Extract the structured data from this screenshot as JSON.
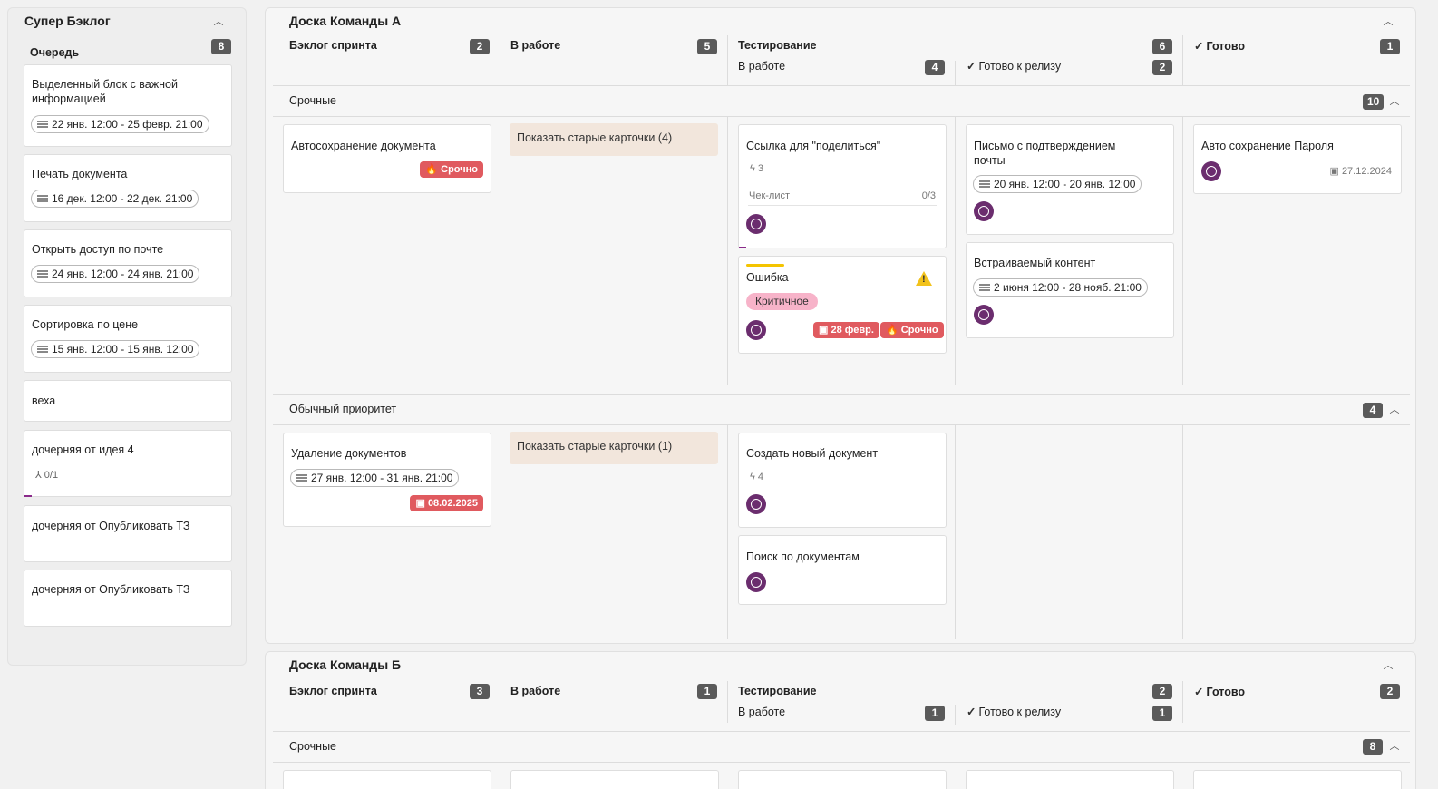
{
  "backlog": {
    "title": "Супер Бэклог",
    "queue_label": "Очередь",
    "queue_count": "8",
    "cards": [
      {
        "title": "Выделенный блок с важной информацией",
        "date": "22 янв. 12:00 - 25 февр. 21:00"
      },
      {
        "title": "Печать документа",
        "date": "16 дек. 12:00 - 22 дек. 21:00"
      },
      {
        "title": "Открыть доступ по почте",
        "date": "24 янв. 12:00 - 24 янв. 21:00"
      },
      {
        "title": "Сортировка по цене",
        "date": "15 янв. 12:00 - 15 янв. 12:00"
      },
      {
        "title": "веха"
      },
      {
        "title": "дочерняя от идея 4",
        "subtasks": "0/1"
      },
      {
        "title": "дочерняя от Опубликовать ТЗ"
      },
      {
        "title": "дочерняя от Опубликовать ТЗ"
      }
    ]
  },
  "board_a": {
    "title": "Доска Команды А",
    "columns": [
      {
        "label": "Бэклог спринта",
        "count": "2"
      },
      {
        "label": "В работе",
        "count": "5"
      },
      {
        "label": "Тестирование",
        "count": "6",
        "sub_left": "В работе",
        "sub_left_count": "4",
        "sub_right": "Готово к релизу",
        "sub_right_count": "2"
      },
      {
        "label": "Готово",
        "count": "1"
      }
    ],
    "lanes": [
      {
        "title": "Срочные",
        "count": "10"
      },
      {
        "title": "Обычный приоритет",
        "count": "4"
      }
    ],
    "urgent": {
      "c1": {
        "title": "Автосохранение документа",
        "tag": "Срочно"
      },
      "show_old": "Показать старые карточки (4)",
      "c3": {
        "title": "Ссылка для \"поделиться\"",
        "points": "3",
        "checklist": "Чек-лист",
        "checklist_count": "0/3"
      },
      "c4": {
        "title": "Ошибка",
        "priority": "Критичное",
        "date_tag": "28 февр.",
        "tag": "Срочно"
      },
      "c5": {
        "title": "Письмо с подтверждением почты",
        "date": "20 янв. 12:00 - 20 янв. 12:00"
      },
      "c6": {
        "title": "Встраиваемый контент",
        "date": "2 июня 12:00 - 28 нояб. 21:00"
      },
      "c7": {
        "title": "Авто сохранение Пароля",
        "date": "27.12.2024"
      }
    },
    "normal": {
      "c1": {
        "title": "Удаление документов",
        "date": "27 янв. 12:00 - 31 янв. 21:00",
        "date_tag": "08.02.2025"
      },
      "show_old": "Показать старые карточки (1)",
      "c3": {
        "title": "Создать новый документ",
        "points": "4"
      },
      "c4": {
        "title": "Поиск по документам"
      }
    }
  },
  "board_b": {
    "title": "Доска Команды Б",
    "columns": [
      {
        "label": "Бэклог спринта",
        "count": "3"
      },
      {
        "label": "В работе",
        "count": "1"
      },
      {
        "label": "Тестирование",
        "count": "2",
        "sub_left": "В работе",
        "sub_left_count": "1",
        "sub_right": "Готово к релизу",
        "sub_right_count": "1"
      },
      {
        "label": "Готово",
        "count": "2"
      }
    ],
    "lanes": [
      {
        "title": "Срочные",
        "count": "8"
      }
    ]
  },
  "colors": {
    "urgent": "#e05a5f",
    "avatar": "#6b2d6e",
    "badge": "#5a5a5a",
    "show_old_bg": "#f2e6dc",
    "critical": "#f7b3c9",
    "warning": "#f2c21b"
  }
}
